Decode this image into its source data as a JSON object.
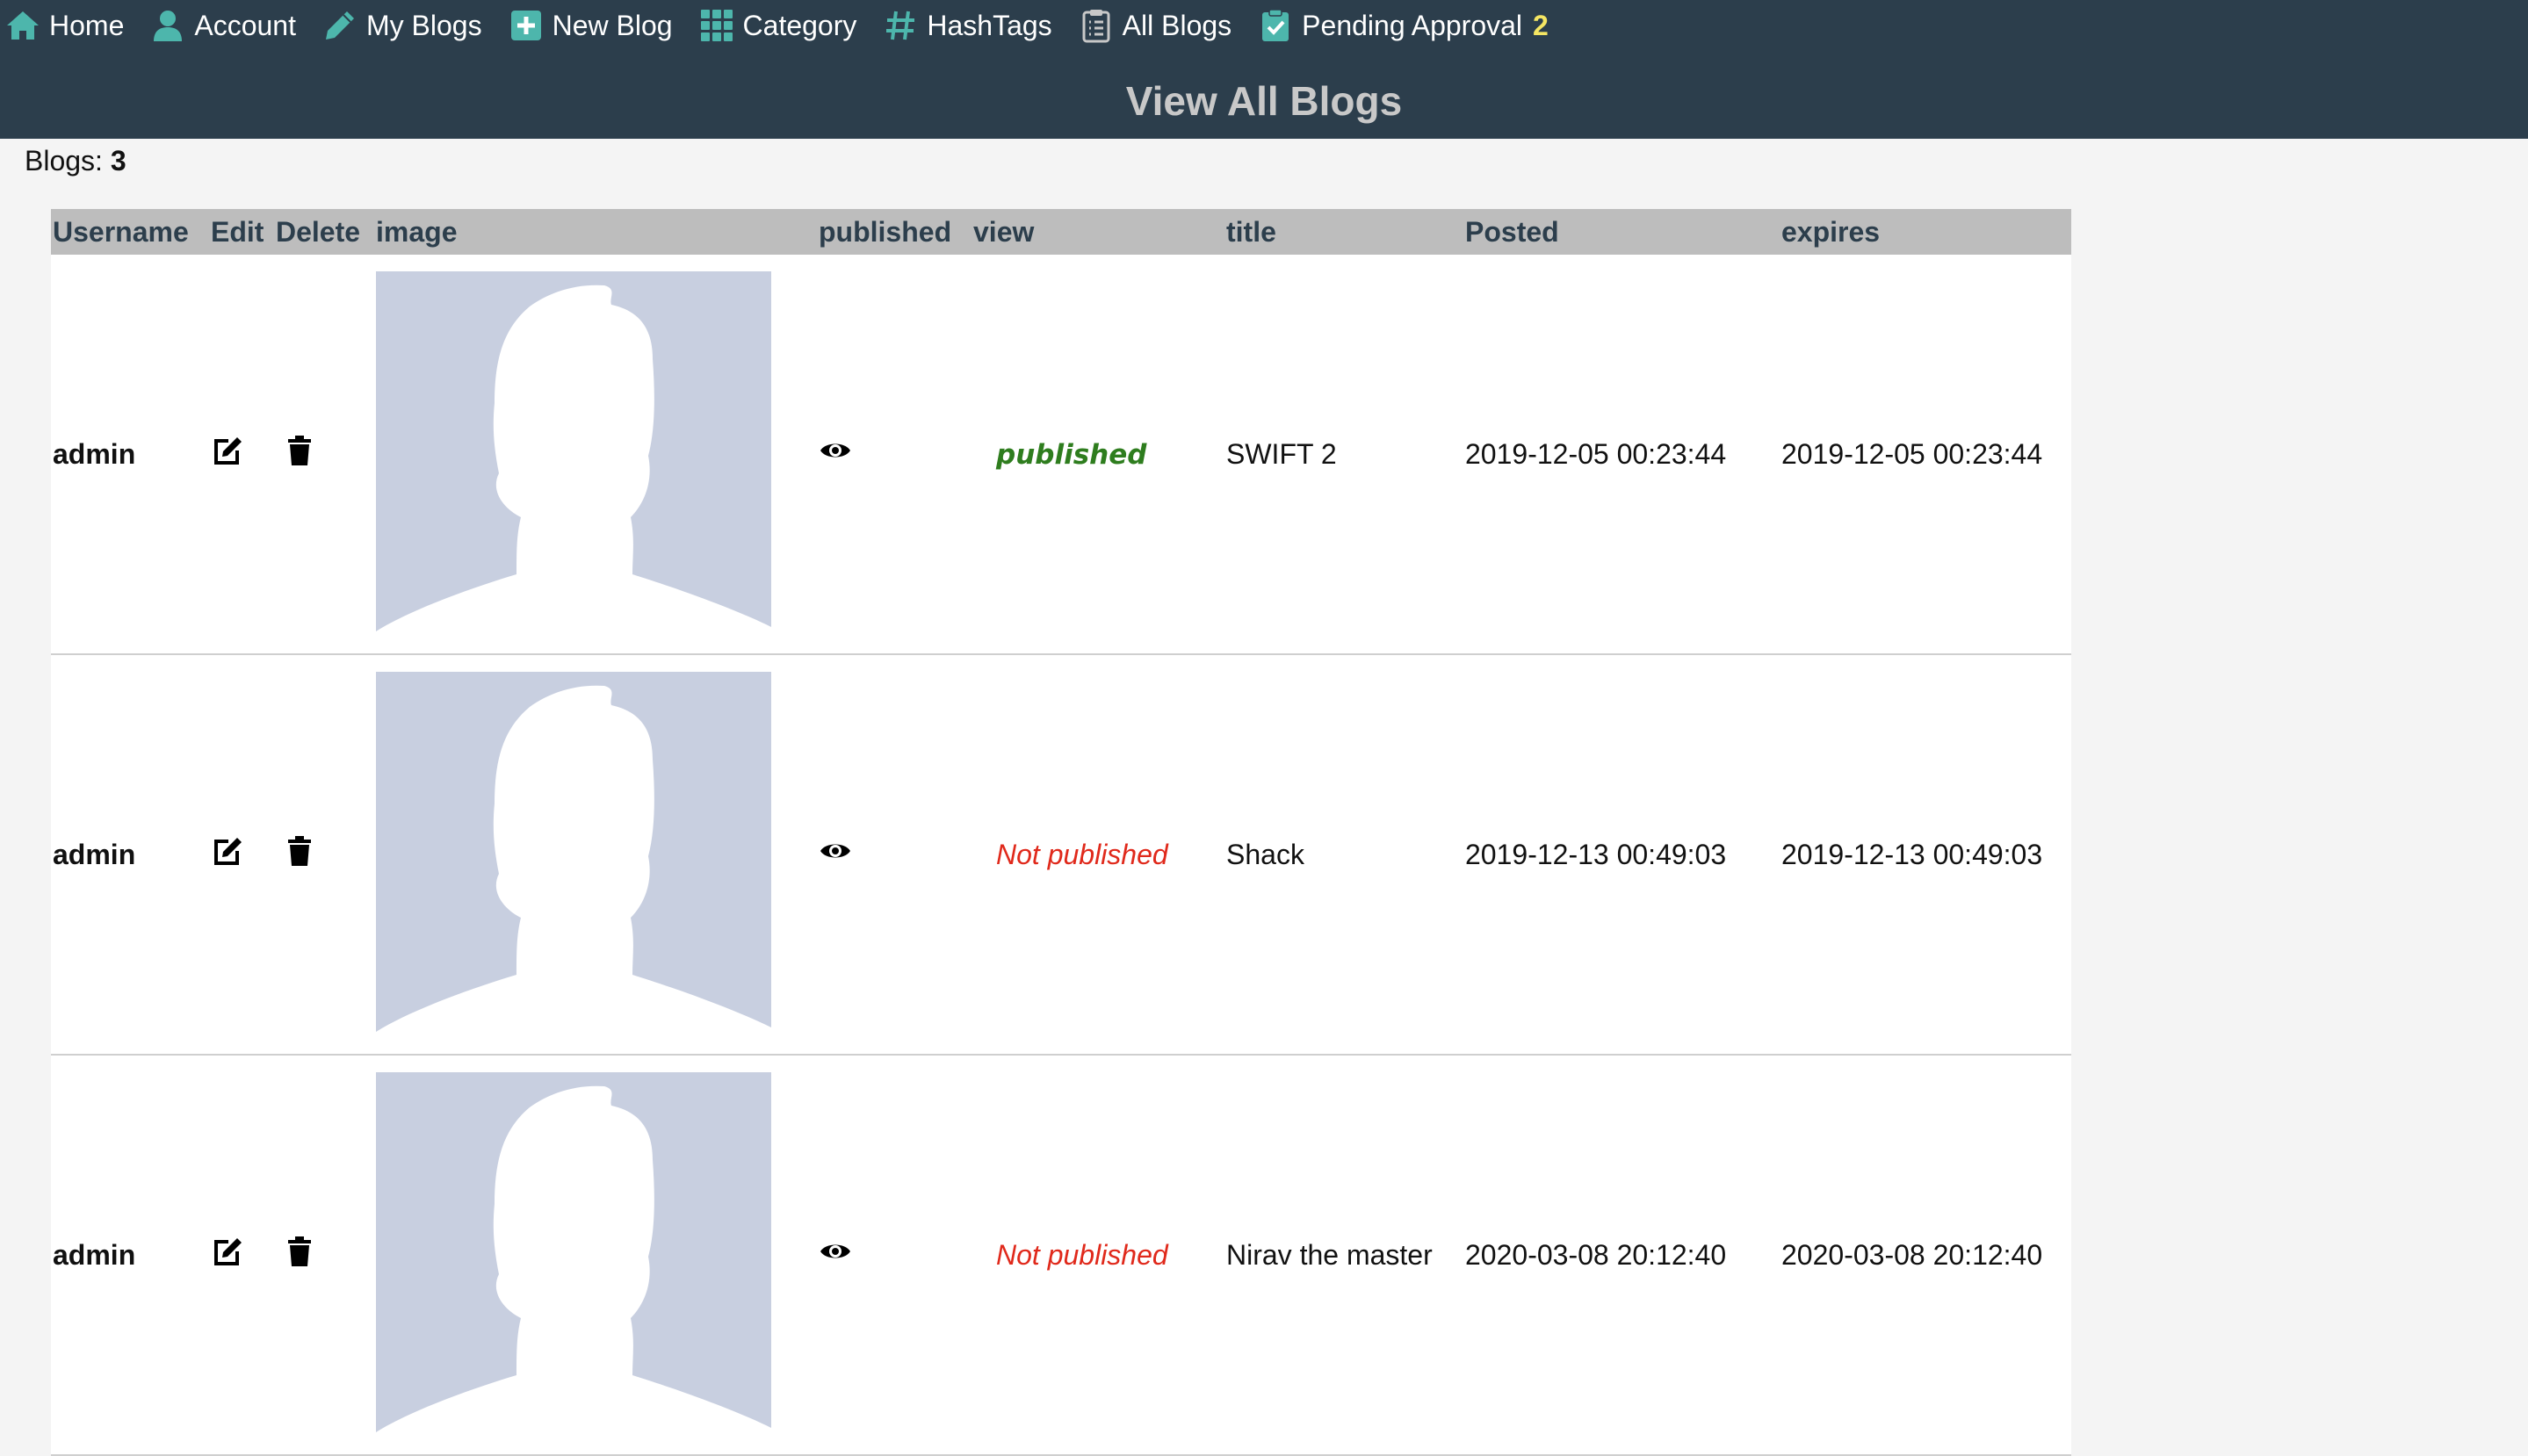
{
  "nav": {
    "items": [
      {
        "label": "Home",
        "icon": "home-icon"
      },
      {
        "label": "Account",
        "icon": "user-icon"
      },
      {
        "label": "My Blogs",
        "icon": "pencil-icon"
      },
      {
        "label": "New Blog",
        "icon": "plus-square-icon"
      },
      {
        "label": "Category",
        "icon": "grid-icon"
      },
      {
        "label": "HashTags",
        "icon": "hashtag-icon"
      },
      {
        "label": "All Blogs",
        "icon": "clipboard-list-icon"
      },
      {
        "label": "Pending Approval",
        "icon": "clipboard-check-icon"
      }
    ],
    "pending_count": "2"
  },
  "page_title": "View All Blogs",
  "blog_count": {
    "label": "Blogs:",
    "value": "3"
  },
  "table": {
    "headers": {
      "username": "Username",
      "edit": "Edit",
      "delete": "Delete",
      "image": "image",
      "published": "published",
      "view": "view",
      "title": "title",
      "posted": "Posted",
      "expires": "expires"
    },
    "rows": [
      {
        "username": "admin",
        "status": "published",
        "status_type": "published",
        "title": "SWIFT 2",
        "posted": "2019-12-05 00:23:44",
        "expires": "2019-12-05 00:23:44"
      },
      {
        "username": "admin",
        "status": "Not published",
        "status_type": "not-published",
        "title": "Shack",
        "posted": "2019-12-13 00:49:03",
        "expires": "2019-12-13 00:49:03"
      },
      {
        "username": "admin",
        "status": "Not published",
        "status_type": "not-published",
        "title": "Nirav the master",
        "posted": "2020-03-08 20:12:40",
        "expires": "2020-03-08 20:12:40"
      }
    ]
  },
  "colors": {
    "header_bg": "#2c3e4c",
    "nav_icon": "#4db6ac",
    "pending_count": "#f5e663",
    "published": "#2e7d1e",
    "not_published": "#e0291b",
    "avatar_bg": "#c8cfe0"
  }
}
